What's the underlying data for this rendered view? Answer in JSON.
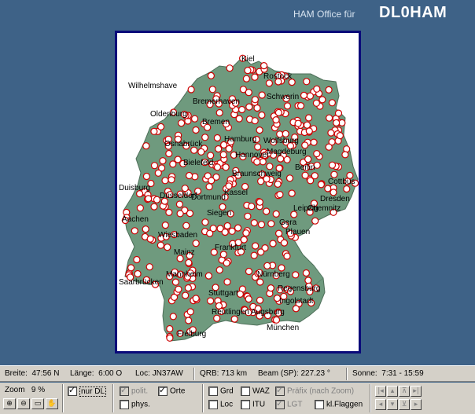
{
  "header": {
    "label": "HAM Office für",
    "callsign": "DL0HAM"
  },
  "colors": {
    "background": "#3e6287",
    "land": "#6f9a7e",
    "border_frame": "#0a0a7a",
    "marker": "#cc0000"
  },
  "map": {
    "cities": [
      "Kiel",
      "Rostock",
      "Wilhelmshaven",
      "Bremerhaven",
      "Schwerin",
      "Oldenburg",
      "Bremen",
      "Hamburg",
      "Osnabrück",
      "Hannover",
      "Wolfsburg",
      "Magdeburg",
      "Bielefeld",
      "Braunschweig",
      "Berlin",
      "Dortmund",
      "Duisburg",
      "Düsseldorf",
      "Kassel",
      "Leipzig",
      "Dresden",
      "Chemnitz",
      "Aachen",
      "Siegen",
      "Gera",
      "Cottbus",
      "Wiesbaden",
      "Mainz",
      "Frankfurt",
      "Plauen",
      "Saarbrücken",
      "Mannheim",
      "Nürnberg",
      "Regensburg",
      "Stuttgart",
      "Ingolstadt",
      "Reutlingen",
      "Augsburg",
      "München",
      "Freiburg"
    ],
    "city_labels_visible": [
      "Kiel",
      "Rostock",
      "Wilhelmshave",
      "Bremerhaven",
      "Schwerin",
      "Oldenburg",
      "Bremen",
      "Hamburg",
      "Osnabrück",
      "Hannover",
      "Wolfsburg",
      "Magdeburg",
      "Bielefeld",
      "Braunschweig",
      "Berlin",
      "Dortmund",
      "Duisburg",
      "Düsseldorf",
      "Kassel",
      "Leipzig",
      "Dresden",
      "Chemnitz",
      "Aachen",
      "Siegen",
      "Gera",
      "Cottbus",
      "Wiesbaden",
      "Mainz",
      "Frankfurt",
      "Plauen",
      "Saarbrücken",
      "Mannheim",
      "Nürnberg",
      "Regensburg",
      "Stuttgart",
      "Ingolstadt",
      "Reutlingen",
      "Augsburg",
      "München",
      "Freiburg"
    ]
  },
  "status": {
    "breite_label": "Breite:",
    "breite": "47:56 N",
    "laenge_label": "Länge:",
    "laenge": "6:00 O",
    "loc_label": "Loc:",
    "loc": "JN37AW",
    "qrb_label": "QRB:",
    "qrb": "713 km",
    "beam_label": "Beam (SP):",
    "beam": "227.23 °",
    "sonne_label": "Sonne:",
    "sonne": "7:31 - 15:59"
  },
  "controls": {
    "zoom_label": "Zoom",
    "zoom_value": "9 %",
    "nur_dl": "nur DL",
    "polit": "polit.",
    "orte": "Orte",
    "phys": "phys.",
    "grd": "Grd",
    "loc": "Loc",
    "waz": "WAZ",
    "itu": "ITU",
    "praefix": "Präfix (nach Zoom)",
    "lgt": "LGT",
    "flaggen": "kl.Flaggen"
  }
}
